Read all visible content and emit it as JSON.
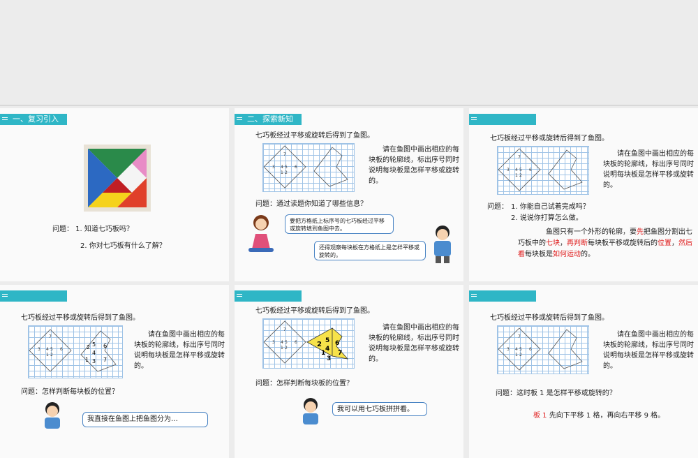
{
  "colors": {
    "accent": "#2fb6c6",
    "highlight": "#e02020",
    "fish_yellow": "#f7e24a"
  },
  "tangram_figure_labels": [
    "7",
    "3",
    "4",
    "5",
    "6",
    "1",
    "2"
  ],
  "slide1": {
    "tag": "一、复习引入",
    "q1": "问题：  1. 知道七巧板吗？",
    "q2": "2. 你对七巧板有什么了解？"
  },
  "slide2": {
    "tag": "二、探索新知",
    "heading": "七巧板经过平移或旋转后得到了鱼图。",
    "instruction": "请在鱼图中画出相应的每块板的轮廓线，标出序号同时说明每块板是怎样平移或旋转的。",
    "question": "问题：通过读题你知道了哪些信息？",
    "bubble1": "要把方格纸上标序号的七巧板经过平移或旋转填到鱼图中去。",
    "bubble2": "还得观察每块板在方格纸上是怎样平移或旋转的。"
  },
  "slide3": {
    "heading": "七巧板经过平移或旋转后得到了鱼图。",
    "instruction": "请在鱼图中画出相应的每块板的轮廓线，标出序号同时说明每块板是怎样平移或旋转的。",
    "q_label": "问题：",
    "q1": "1. 你能自己试着完成吗？",
    "q2": "2. 说说你打算怎么做。",
    "ans": {
      "p1": "鱼图只有一个外形的轮廓，要",
      "p2": "先",
      "p3": "把鱼图分割出七巧板中的",
      "p4": "七块",
      "p5": "，",
      "p6": "再判断",
      "p7": "每块板平移或旋转后的",
      "p8": "位置",
      "p9": "，",
      "p10": "然后看",
      "p11": "每块板是",
      "p12": "如何运动",
      "p13": "的。"
    }
  },
  "slide4": {
    "heading": "七巧板经过平移或旋转后得到了鱼图。",
    "instruction": "请在鱼图中画出相应的每块板的轮廓线，标出序号同时说明每块板是怎样平移或旋转的。",
    "question": "问题：怎样判断每块板的位置？",
    "bubble": "我直接在鱼图上把鱼图分为…",
    "fish_labels": [
      "2",
      "5",
      "6",
      "4",
      "1",
      "3",
      "7"
    ]
  },
  "slide5": {
    "heading": "七巧板经过平移或旋转后得到了鱼图。",
    "instruction": "请在鱼图中画出相应的每块板的轮廓线，标出序号同时说明每块板是怎样平移或旋转的。",
    "question": "问题：怎样判断每块板的位置？",
    "bubble": "我可以用七巧板拼拼看。",
    "fish_labels": [
      "2",
      "5",
      "4",
      "6",
      "1",
      "3",
      "7"
    ]
  },
  "slide6": {
    "heading": "七巧板经过平移或旋转后得到了鱼图。",
    "instruction": "请在鱼图中画出相应的每块板的轮廓线，标出序号同时说明每块板是怎样平移或旋转的。",
    "question": "问题：这时板 1 是怎样平移或旋转的？",
    "ans_a": "板 1",
    "ans_b": " 先向下平移 1 格，再向右平移 9 格。"
  }
}
